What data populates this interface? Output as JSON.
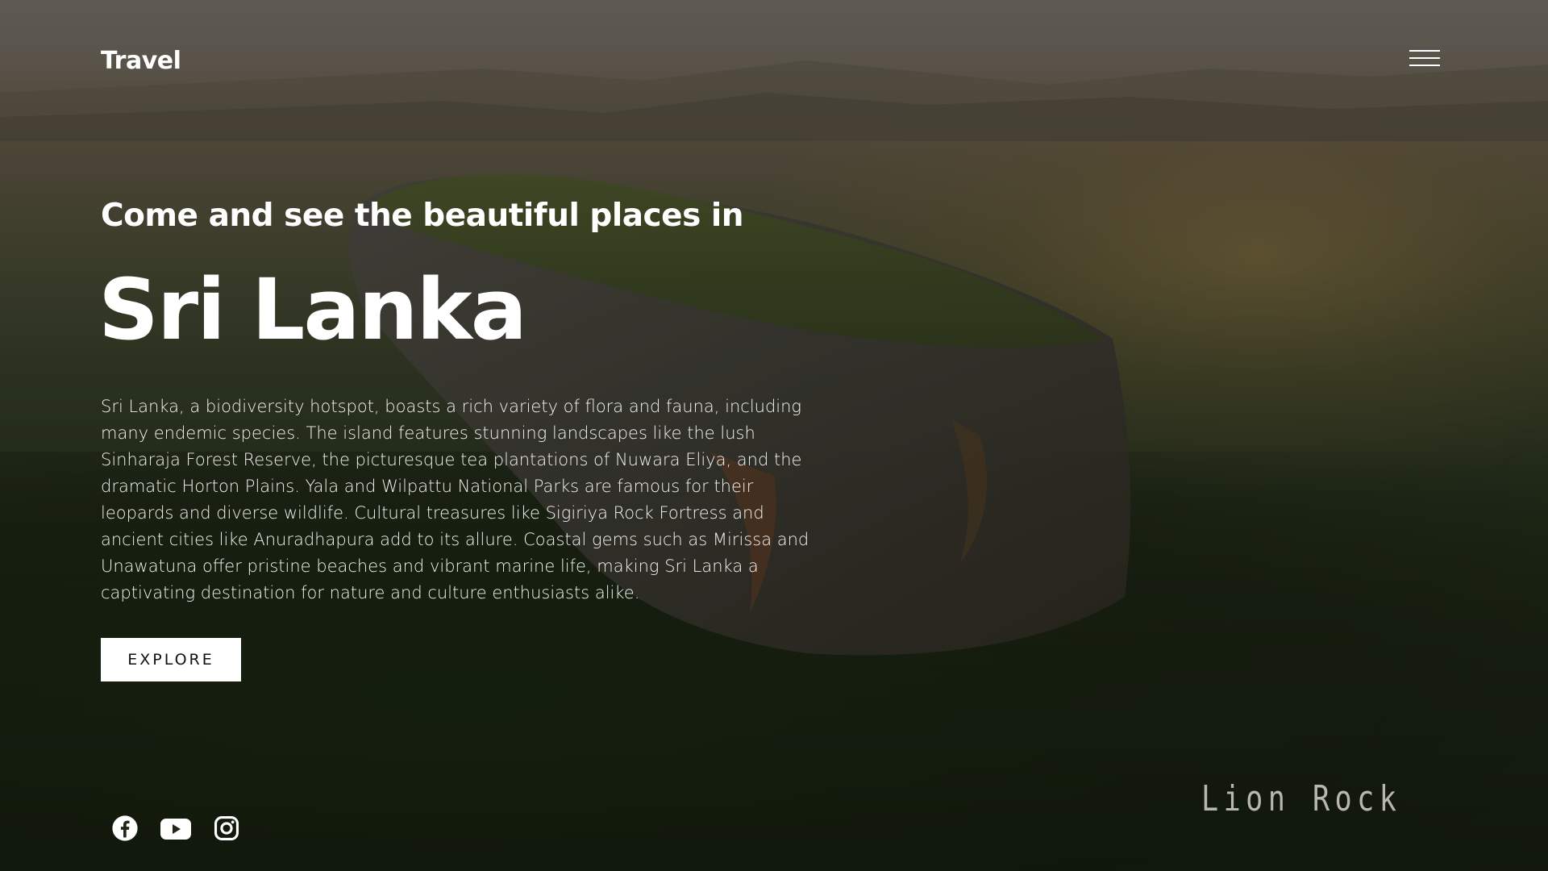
{
  "header": {
    "logo": "Travel"
  },
  "hero": {
    "subtitle": "Come and see the beautiful places in",
    "title": "Sri Lanka",
    "description": "Sri Lanka, a biodiversity hotspot, boasts a rich variety of flora and fauna, including many endemic species. The island features stunning landscapes like the lush Sinharaja Forest Reserve, the picturesque tea plantations of Nuwara Eliya, and the dramatic Horton Plains. Yala and Wilpattu National Parks are famous for their leopards and diverse wildlife. Cultural treasures like Sigiriya Rock Fortress and ancient cities like Anuradhapura add to its allure. Coastal gems such as Mirissa and Unawatuna offer pristine beaches and vibrant marine life, making Sri Lanka a captivating destination for nature and culture enthusiasts alike.",
    "explore_label": "EXPLORE",
    "place_label": "Lion Rock"
  },
  "social": {
    "icons": [
      "facebook-icon",
      "youtube-icon",
      "instagram-icon"
    ]
  },
  "colors": {
    "text": "#ffffff",
    "button_bg": "#ffffff",
    "button_text": "#111111",
    "place_label": "#b8b6ad"
  }
}
